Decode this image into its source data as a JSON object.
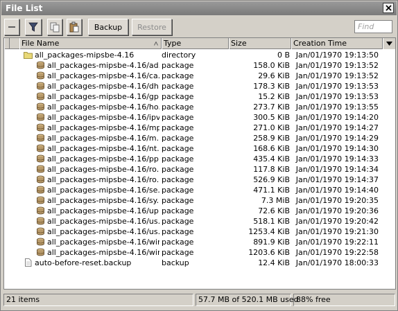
{
  "window": {
    "title": "File List"
  },
  "toolbar": {
    "backup_label": "Backup",
    "restore_label": "Restore",
    "find_placeholder": "Find"
  },
  "columns": {
    "name": "File Name",
    "type": "Type",
    "size": "Size",
    "time": "Creation Time"
  },
  "rows": [
    {
      "icon": "folder-icon",
      "name": "all_packages-mipsbe-4.16",
      "type": "directory",
      "size": "0 B",
      "time": "Jan/01/1970 19:13:50"
    },
    {
      "icon": "package-icon",
      "name": "all_packages-mipsbe-4.16/ad...",
      "type": "package",
      "size": "158.0 KiB",
      "time": "Jan/01/1970 19:13:52"
    },
    {
      "icon": "package-icon",
      "name": "all_packages-mipsbe-4.16/ca...",
      "type": "package",
      "size": "29.6 KiB",
      "time": "Jan/01/1970 19:13:52"
    },
    {
      "icon": "package-icon",
      "name": "all_packages-mipsbe-4.16/dh...",
      "type": "package",
      "size": "178.3 KiB",
      "time": "Jan/01/1970 19:13:53"
    },
    {
      "icon": "package-icon",
      "name": "all_packages-mipsbe-4.16/gp...",
      "type": "package",
      "size": "15.2 KiB",
      "time": "Jan/01/1970 19:13:53"
    },
    {
      "icon": "package-icon",
      "name": "all_packages-mipsbe-4.16/ho...",
      "type": "package",
      "size": "273.7 KiB",
      "time": "Jan/01/1970 19:13:55"
    },
    {
      "icon": "package-icon",
      "name": "all_packages-mipsbe-4.16/ipv...",
      "type": "package",
      "size": "300.5 KiB",
      "time": "Jan/01/1970 19:14:20"
    },
    {
      "icon": "package-icon",
      "name": "all_packages-mipsbe-4.16/mp...",
      "type": "package",
      "size": "271.0 KiB",
      "time": "Jan/01/1970 19:14:27"
    },
    {
      "icon": "package-icon",
      "name": "all_packages-mipsbe-4.16/m...",
      "type": "package",
      "size": "258.9 KiB",
      "time": "Jan/01/1970 19:14:29"
    },
    {
      "icon": "package-icon",
      "name": "all_packages-mipsbe-4.16/nt...",
      "type": "package",
      "size": "168.6 KiB",
      "time": "Jan/01/1970 19:14:30"
    },
    {
      "icon": "package-icon",
      "name": "all_packages-mipsbe-4.16/pp...",
      "type": "package",
      "size": "435.4 KiB",
      "time": "Jan/01/1970 19:14:33"
    },
    {
      "icon": "package-icon",
      "name": "all_packages-mipsbe-4.16/ro...",
      "type": "package",
      "size": "117.8 KiB",
      "time": "Jan/01/1970 19:14:34"
    },
    {
      "icon": "package-icon",
      "name": "all_packages-mipsbe-4.16/ro...",
      "type": "package",
      "size": "526.9 KiB",
      "time": "Jan/01/1970 19:14:37"
    },
    {
      "icon": "package-icon",
      "name": "all_packages-mipsbe-4.16/se...",
      "type": "package",
      "size": "471.1 KiB",
      "time": "Jan/01/1970 19:14:40"
    },
    {
      "icon": "package-icon",
      "name": "all_packages-mipsbe-4.16/sy...",
      "type": "package",
      "size": "7.3 MiB",
      "time": "Jan/01/1970 19:20:35"
    },
    {
      "icon": "package-icon",
      "name": "all_packages-mipsbe-4.16/up...",
      "type": "package",
      "size": "72.6 KiB",
      "time": "Jan/01/1970 19:20:36"
    },
    {
      "icon": "package-icon",
      "name": "all_packages-mipsbe-4.16/us...",
      "type": "package",
      "size": "518.1 KiB",
      "time": "Jan/01/1970 19:20:42"
    },
    {
      "icon": "package-icon",
      "name": "all_packages-mipsbe-4.16/us...",
      "type": "package",
      "size": "1253.4 KiB",
      "time": "Jan/01/1970 19:21:30"
    },
    {
      "icon": "package-icon",
      "name": "all_packages-mipsbe-4.16/wir...",
      "type": "package",
      "size": "891.9 KiB",
      "time": "Jan/01/1970 19:22:11"
    },
    {
      "icon": "package-icon",
      "name": "all_packages-mipsbe-4.16/wir...",
      "type": "package",
      "size": "1203.6 KiB",
      "time": "Jan/01/1970 19:22:58"
    },
    {
      "icon": "file-icon",
      "name": "auto-before-reset.backup",
      "type": "backup",
      "size": "12.4 KiB",
      "time": "Jan/01/1970 18:00:33"
    }
  ],
  "status": {
    "items": "21 items",
    "used": "57.7 MB of 520.1 MB used",
    "free": "88% free"
  },
  "colors": {
    "titlebar": "#8a8a8a",
    "window_bg": "#d4d0c8",
    "folder": "#e8d878",
    "package": "#b89a6a"
  }
}
